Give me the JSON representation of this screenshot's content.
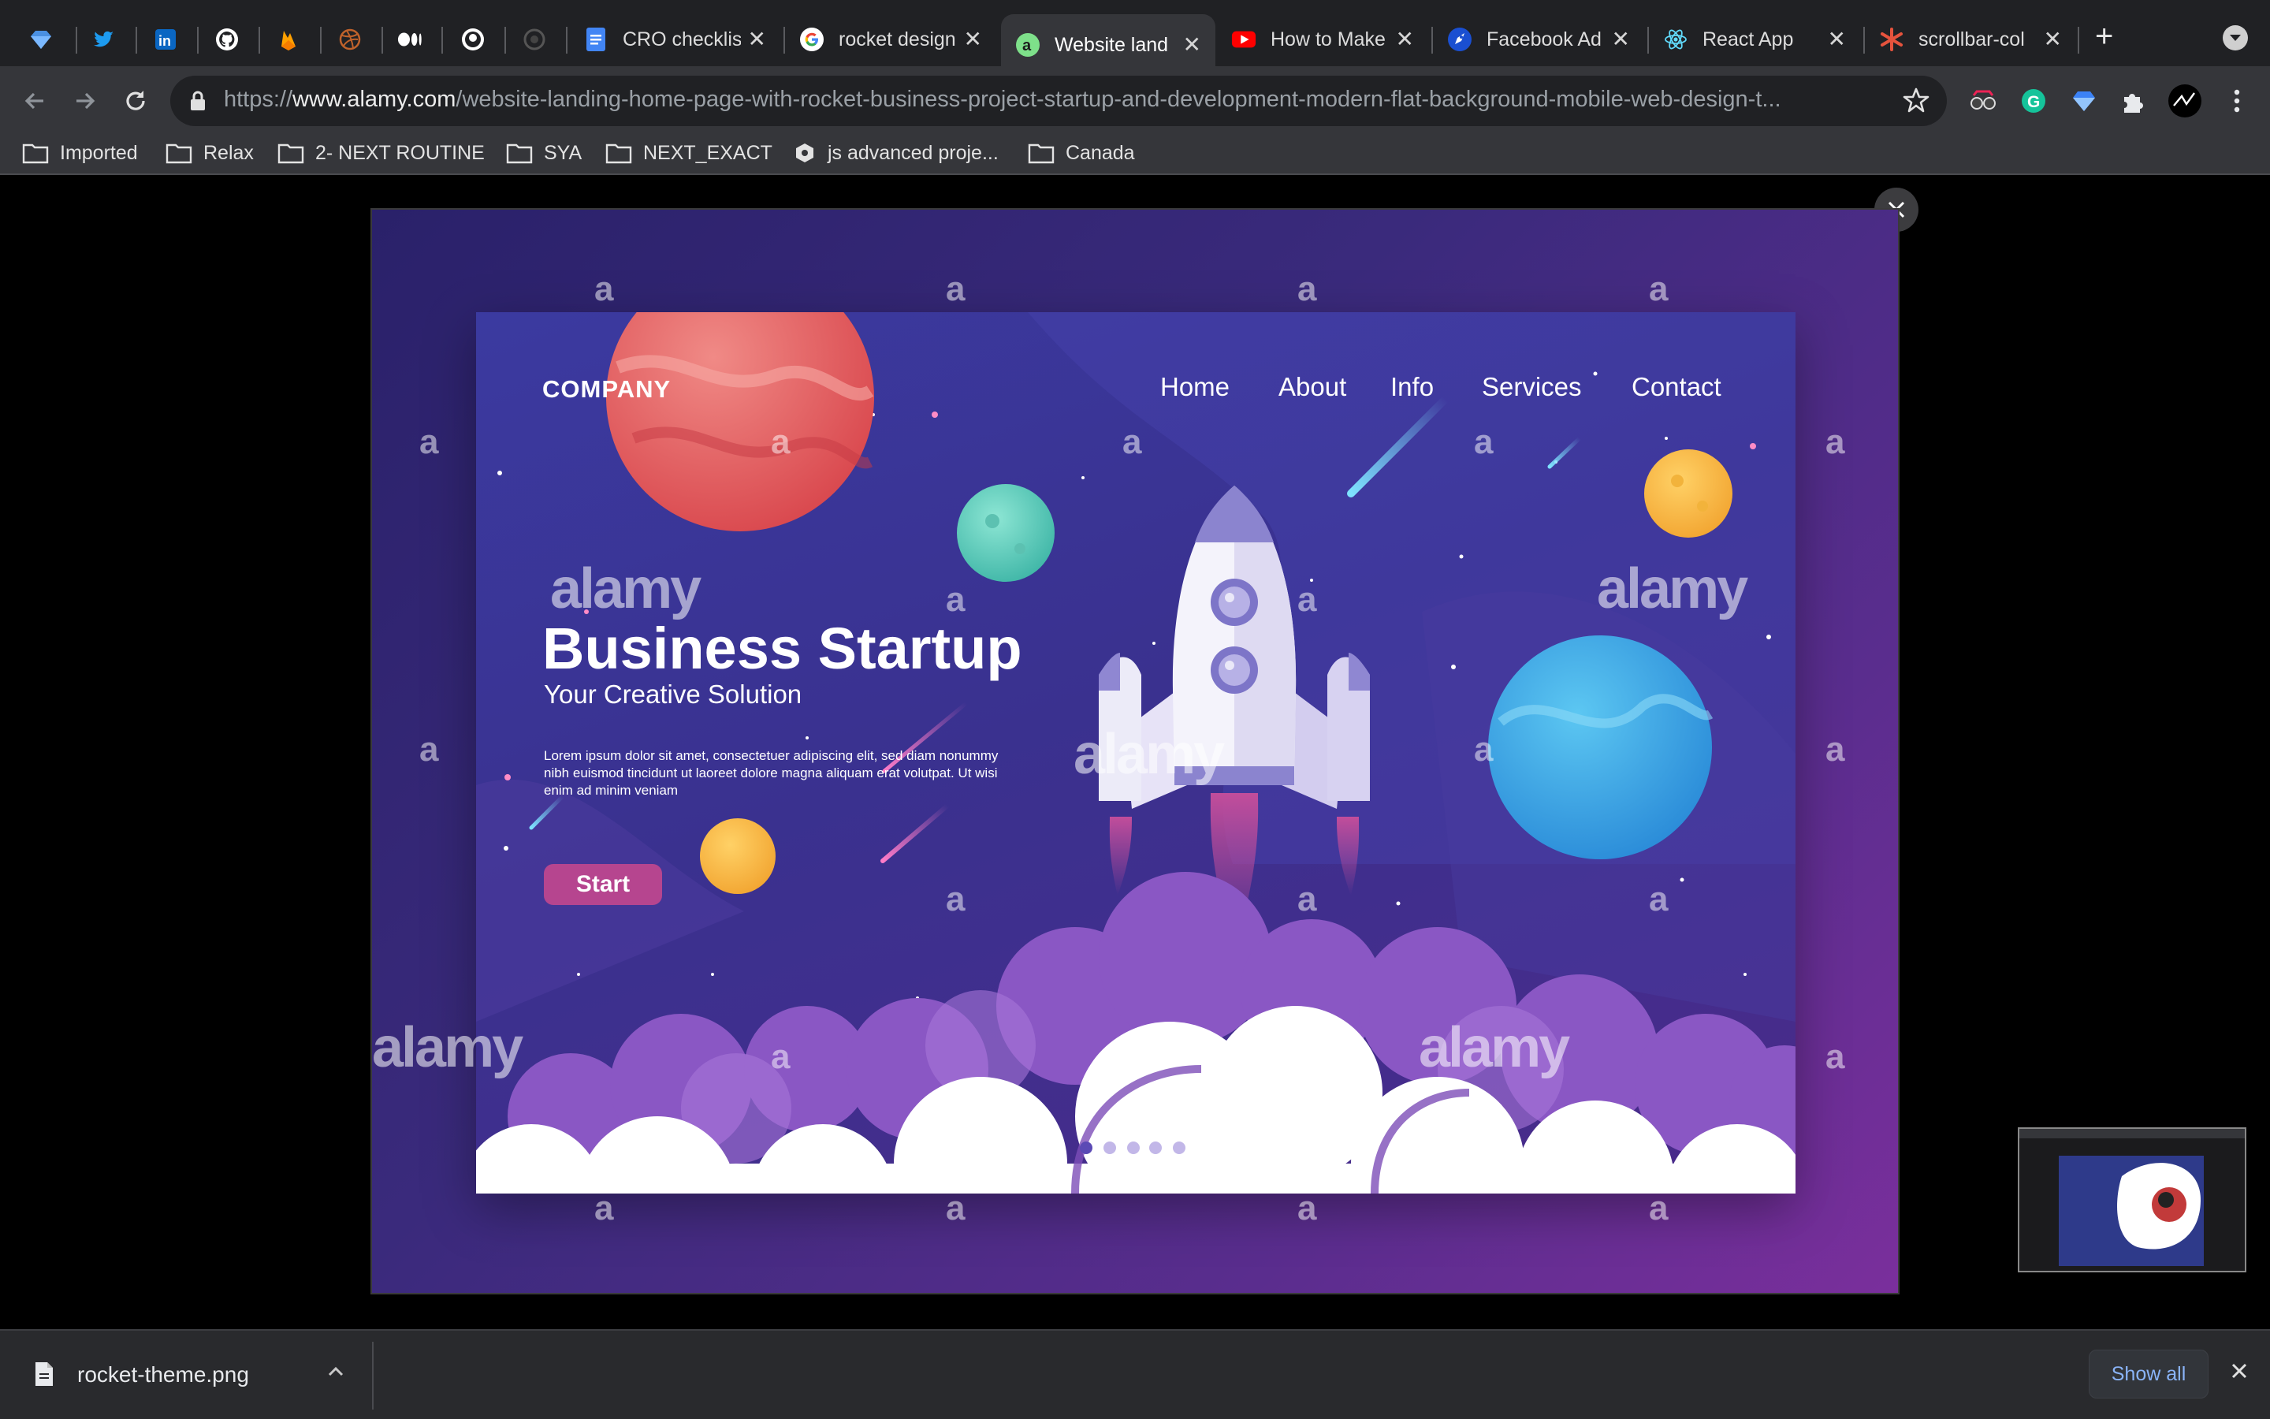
{
  "tabs": [
    {
      "title": "",
      "icon": "diamond-favicon"
    },
    {
      "title": "",
      "icon": "twitter-favicon"
    },
    {
      "title": "",
      "icon": "linkedin-favicon"
    },
    {
      "title": "",
      "icon": "github-favicon"
    },
    {
      "title": "",
      "icon": "firebase-favicon"
    },
    {
      "title": "",
      "icon": "basketball-favicon"
    },
    {
      "title": "",
      "icon": "medium-favicon"
    },
    {
      "title": "",
      "icon": "github-favicon"
    },
    {
      "title": "",
      "icon": "loading-favicon"
    },
    {
      "title": "CRO checklis",
      "icon": "docs-favicon"
    },
    {
      "title": "rocket design",
      "icon": "google-favicon"
    },
    {
      "title": "Website land",
      "icon": "alamy-favicon",
      "active": true
    },
    {
      "title": "How to Make",
      "icon": "youtube-favicon"
    },
    {
      "title": "Facebook Ad",
      "icon": "rocket-favicon"
    },
    {
      "title": "React App",
      "icon": "react-favicon"
    },
    {
      "title": "scrollbar-col",
      "icon": "asterisk-favicon"
    }
  ],
  "address_bar": {
    "url_prefix": "https://",
    "url_host": "www.alamy.com",
    "url_path": "/website-landing-home-page-with-rocket-business-project-startup-and-development-modern-flat-background-mobile-web-design-t..."
  },
  "bookmarks": [
    {
      "label": "Imported",
      "icon": "folder-icon"
    },
    {
      "label": "Relax",
      "icon": "folder-icon"
    },
    {
      "label": "2- NEXT ROUTINE",
      "icon": "folder-icon"
    },
    {
      "label": "SYA",
      "icon": "folder-icon"
    },
    {
      "label": "NEXT_EXACT",
      "icon": "folder-icon"
    },
    {
      "label": "js advanced proje...",
      "icon": "puzzle-favicon"
    },
    {
      "label": "Canada",
      "icon": "folder-icon"
    }
  ],
  "landing": {
    "company": "COMPANY",
    "nav": [
      "Home",
      "About",
      "Info",
      "Services",
      "Contact"
    ],
    "title": "Business Startup",
    "subtitle": "Your Creative Solution",
    "body": "Lorem ipsum dolor sit amet, consectetuer adipiscing elit, sed diam nonummy nibh euismod tincidunt ut laoreet dolore magna aliquam erat volutpat. Ut wisi enim ad minim veniam",
    "cta": "Start",
    "slides": 5,
    "active_slide": 1
  },
  "watermark": {
    "letter": "a",
    "brand": "alamy"
  },
  "downloads": {
    "file_name": "rocket-theme.png",
    "show_all": "Show all"
  },
  "colors": {
    "accent_purple": "#5a2d8e",
    "cta_pink": "#b6458f",
    "link_blue": "#8ab4f8"
  }
}
